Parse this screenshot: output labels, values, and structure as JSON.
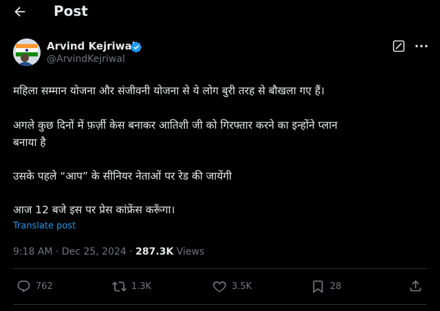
{
  "header": {
    "title": "Post",
    "back_icon": "arrow-left-icon"
  },
  "author": {
    "name": "Arvind Kejriwal",
    "handle": "@ArvindKejriwal",
    "verified": true,
    "verified_color": "#1d9bf0"
  },
  "post": {
    "lines": [
      "महिला सम्मान योजना और संजीवनी योजना से ये लोग बुरी तरह से बौखला गए हैं।",
      "अगले कुछ दिनों में फ़र्ज़ी केस बनाकर आतिशी जी को गिरफ्तार करने का इन्होंने प्लान",
      "बनाया है",
      "उसके पहले “आप” के सीनियर नेताओं पर रेड की जायेंगी",
      "आज 12 बजे इस पर प्रेस कांफ्रेंस करूँगा।"
    ],
    "translate_label": "Translate post"
  },
  "meta": {
    "time": "9:18 AM",
    "separator": "·",
    "date": "Dec 25, 2024",
    "views_count": "287.3K",
    "views_label": "Views"
  },
  "actions": {
    "replies": "762",
    "reposts": "1.3K",
    "likes": "3.5K",
    "bookmarks": "28"
  },
  "colors": {
    "background": "#000000",
    "text": "#e7e9ea",
    "muted": "#71767b",
    "accent": "#1d9bf0",
    "divider": "#2f3336"
  }
}
